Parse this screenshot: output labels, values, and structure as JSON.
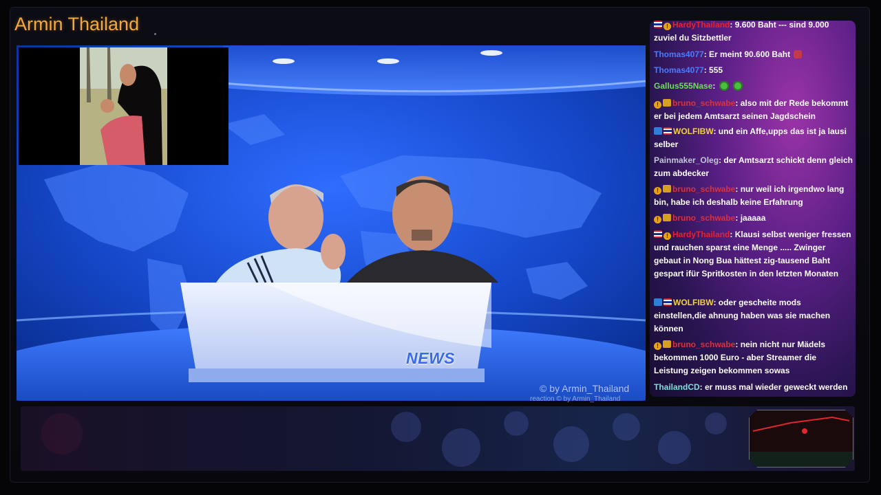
{
  "channel": {
    "title": "Armin Thailand"
  },
  "stream": {
    "watermark": "© by Armin_Thailand",
    "reaction_watermark": "reaction  © by Armin_Thailand",
    "desk_logo": "NEWS"
  },
  "chat": {
    "messages": [
      {
        "badges": [
          "flag-th",
          "warn"
        ],
        "user": "HardyThailand",
        "user_color": "#e8232d",
        "text": ": 9.600 Baht --- sind 9.000 zuviel du Sitzbettler",
        "emote": ""
      },
      {
        "badges": [],
        "user": "Thomas4077",
        "user_color": "#4b7cff",
        "text": ": Er meint 90.600 Baht",
        "emote": "red"
      },
      {
        "badges": [],
        "user": "Thomas4077",
        "user_color": "#4b7cff",
        "text": ": 555",
        "emote": ""
      },
      {
        "badges": [],
        "user": "Gallus555Nase",
        "user_color": "#6ee05a",
        "text": ":",
        "emote": "green2"
      },
      {
        "badges": [
          "warn",
          "fire"
        ],
        "user": "bruno_schwabe",
        "user_color": "#d8333d",
        "text": ": also mit der Rede bekommt er bei jedem Amtsarzt seinen Jagdschein",
        "emote": ""
      },
      {
        "badges": [
          "prime",
          "flag-th"
        ],
        "user": "WOLFIBW",
        "user_color": "#f2d23a",
        "text": ": und ein Affe,upps das ist ja lausi selber",
        "emote": ""
      },
      {
        "badges": [],
        "user": "Painmaker_Oleg",
        "user_color": "#c4c6d8",
        "text": ": der Amtsarzt schickt denn gleich zum abdecker",
        "emote": ""
      },
      {
        "badges": [
          "warn",
          "fire"
        ],
        "user": "bruno_schwabe",
        "user_color": "#d8333d",
        "text": ": nur weil ich irgendwo lang bin, habe ich deshalb keine Erfahrung",
        "emote": ""
      },
      {
        "badges": [
          "warn",
          "fire"
        ],
        "user": "bruno_schwabe",
        "user_color": "#d8333d",
        "text": ": jaaaaa",
        "emote": ""
      },
      {
        "badges": [
          "flag-th",
          "warn"
        ],
        "user": "HardyThailand",
        "user_color": "#e8232d",
        "text": ": Klausi selbst weniger fressen und rauchen sparst eine Menge ..... Zwinger gebaut in Nong Bua hättest zig-tausend Baht gespart ifür Spritkosten in den letzten Monaten",
        "emote": ""
      },
      {
        "badges": [
          "prime",
          "flag-th"
        ],
        "user": "WOLFIBW",
        "user_color": "#f2d23a",
        "text": ": oder gescheite mods einstellen,die ahnung haben was sie machen können",
        "emote": ""
      },
      {
        "badges": [
          "warn",
          "fire"
        ],
        "user": "bruno_schwabe",
        "user_color": "#d8333d",
        "text": ": nein nicht nur Mädels bekommen 1000 Euro - aber Streamer die Leistung zeigen bekommen sowas",
        "emote": ""
      },
      {
        "badges": [],
        "user": "ThailandCD",
        "user_color": "#7fe0d8",
        "text": ": er muss mal wieder geweckt werden",
        "emote": ""
      }
    ]
  }
}
